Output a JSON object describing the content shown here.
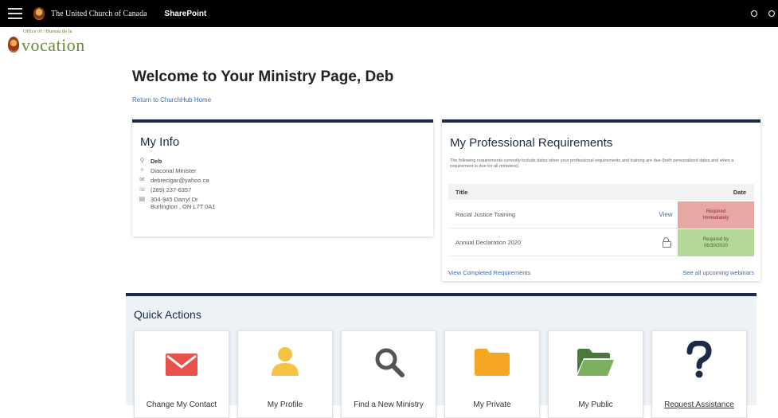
{
  "suite_bar": {
    "org_name": "The United Church of Canada",
    "app_name": "SharePoint"
  },
  "site_logo": {
    "small_text": "Office of / Bureau de la",
    "main_text": "vocation"
  },
  "page": {
    "title": "Welcome to Your Ministry Page, Deb",
    "return_link": "Return to ChurchHub Home"
  },
  "my_info": {
    "title": "My Info",
    "name": "Deb",
    "role": "Diaconal Minister",
    "email": "debrecigar@yahoo.ca",
    "phone": "(289) 237-6357",
    "address_line1": "304-945 Darryl Dr",
    "address_line2": "Burlington , ON L7T 0A1"
  },
  "requirements": {
    "title": "My Professional Requirements",
    "description": "The following requirements currently include dates when your professional requirements and training are due (both personalized dates and when a requirement is due for all ministers).",
    "col_title": "Title",
    "col_date": "Date",
    "rows": [
      {
        "title": "Racial Justice Training",
        "action": "View",
        "date_line1": "Required",
        "date_line2": "Immediately",
        "status_color": "#e8a7a5"
      },
      {
        "title": "Annual Declaration 2020",
        "action_icon": "lock-icon",
        "date_line1": "Required by",
        "date_line2": "06/30/2020",
        "status_color": "#b4d89a"
      }
    ],
    "footer_left": "View Completed Requirements",
    "footer_right": "See all upcoming webinars"
  },
  "quick_actions": {
    "title": "Quick Actions",
    "tiles": [
      {
        "label": "Change My Contact",
        "icon": "envelope-icon",
        "color": "#e8504a"
      },
      {
        "label": "My Profile",
        "icon": "person-icon",
        "color": "#f5c242"
      },
      {
        "label": "Find a New Ministry",
        "icon": "magnifier-icon",
        "color": "#555555"
      },
      {
        "label": "My Private",
        "icon": "folder-icon",
        "color": "#f5a623"
      },
      {
        "label": "My Public",
        "icon": "open-folder-icon",
        "color": "#5a8a4a"
      },
      {
        "label": "Request Assistance",
        "icon": "question-icon",
        "color": "#1b2a45"
      }
    ]
  }
}
